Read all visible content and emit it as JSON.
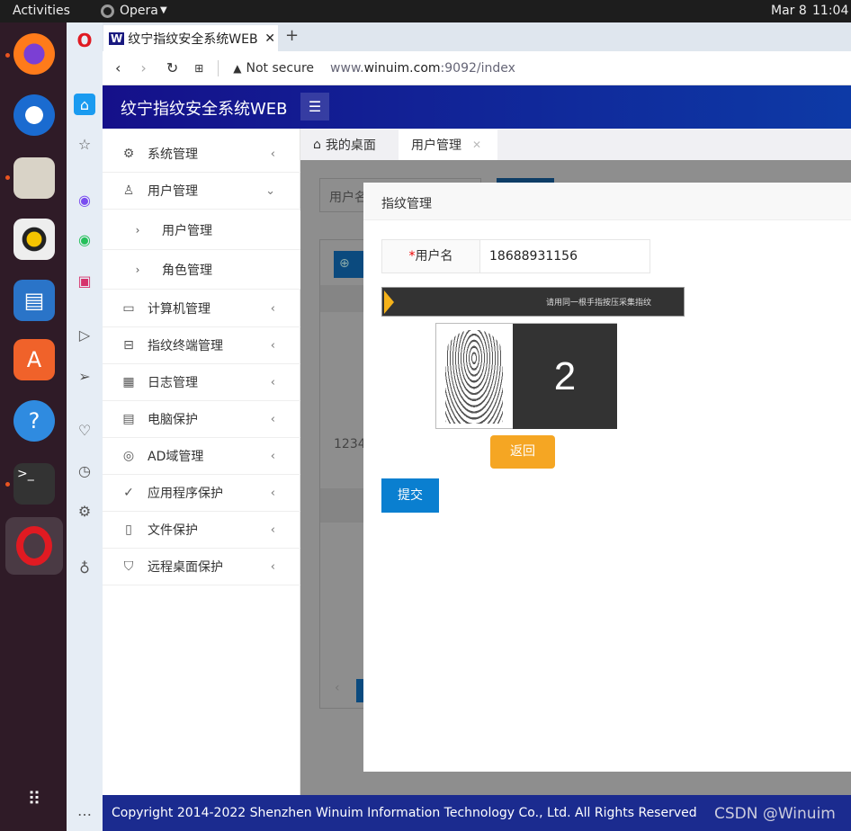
{
  "system_bar": {
    "activities": "Activities",
    "app": "Opera",
    "date": "Mar 8",
    "time": "11:04"
  },
  "dock": {
    "icons": [
      "firefox-icon",
      "thunderbird-icon",
      "files-icon",
      "rhythmbox-icon",
      "writer-icon",
      "app-center-icon",
      "help-icon",
      "terminal-icon",
      "opera-icon",
      "apps-grid-icon"
    ]
  },
  "browser": {
    "tab_title": "纹宁指纹安全系统WEB",
    "security": "Not secure",
    "url_prefix": "www.",
    "url_host": "winuim.com",
    "url_rest": ":9092/index"
  },
  "app": {
    "title": "纹宁指纹安全系统WEB"
  },
  "menu": [
    {
      "label": "系统管理",
      "icon": "gear-icon",
      "glyph": "⚙",
      "chev": "‹"
    },
    {
      "label": "用户管理",
      "icon": "user-icon",
      "glyph": "♙",
      "chev": "⌄"
    },
    {
      "label": "用户管理",
      "icon": "chevron-right-icon",
      "glyph": "›",
      "sub": true
    },
    {
      "label": "角色管理",
      "icon": "chevron-right-icon",
      "glyph": "›",
      "sub": true
    },
    {
      "label": "计算机管理",
      "icon": "monitor-icon",
      "glyph": "▭",
      "chev": "‹"
    },
    {
      "label": "指纹终端管理",
      "icon": "terminal-device-icon",
      "glyph": "⊟",
      "chev": "‹"
    },
    {
      "label": "日志管理",
      "icon": "calendar-icon",
      "glyph": "▦",
      "chev": "‹"
    },
    {
      "label": "电脑保护",
      "icon": "dashboard-icon",
      "glyph": "▤",
      "chev": "‹"
    },
    {
      "label": "AD域管理",
      "icon": "user-circle-icon",
      "glyph": "◎",
      "chev": "‹"
    },
    {
      "label": "应用程序保护",
      "icon": "check-badge-icon",
      "glyph": "✓",
      "chev": "‹"
    },
    {
      "label": "文件保护",
      "icon": "file-lock-icon",
      "glyph": "▯",
      "chev": "‹"
    },
    {
      "label": "远程桌面保护",
      "icon": "shield-icon",
      "glyph": "⛉",
      "chev": "‹"
    }
  ],
  "content_tabs": [
    {
      "label": "我的桌面"
    },
    {
      "label": "用户管理"
    }
  ],
  "background": {
    "search_placeholder": "用户名",
    "row_text": "12345"
  },
  "modal": {
    "title": "指纹管理",
    "required_mark": "*",
    "username_label": "用户名",
    "username_value": "18688931156",
    "instruction": "请用同一根手指按压采集指纹",
    "count": "2",
    "back_button": "返回",
    "submit_button": "提交"
  },
  "footer": {
    "copyright": "Copyright 2014-2022 Shenzhen Winuim Information Technology Co., Ltd. All Rights Reserved",
    "watermark": "CSDN @Winuim"
  },
  "colors": {
    "header": "#15108a",
    "submit": "#0a7fd0",
    "back": "#f5a623",
    "footer": "#1b2b8f"
  }
}
